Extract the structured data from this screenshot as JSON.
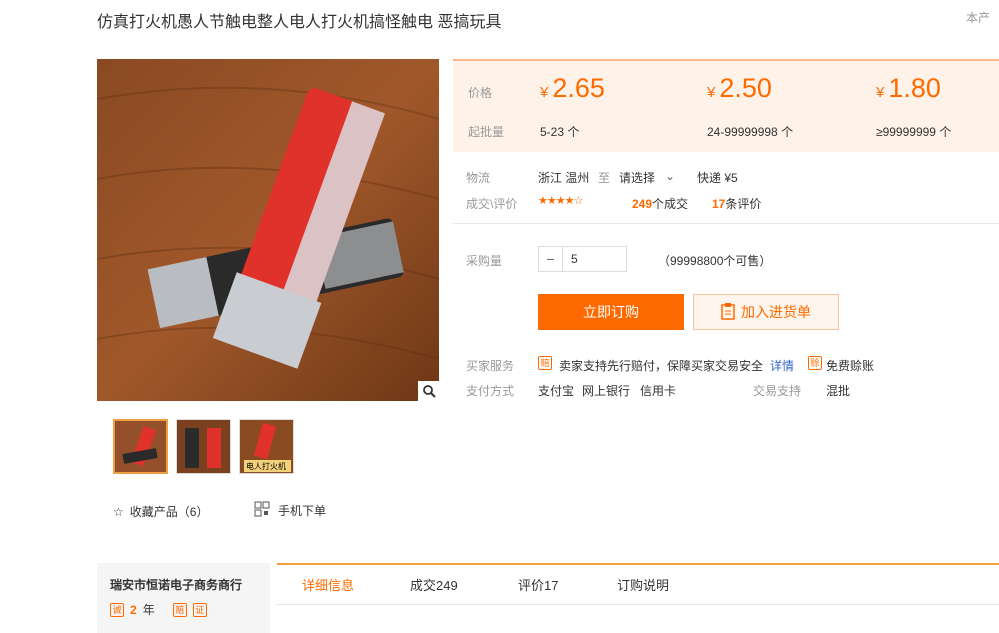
{
  "title": "仿真打火机愚人节触电整人电人打火机搞怪触电 恶搞玩具",
  "corner_text": "本产",
  "price": {
    "price_label": "价格",
    "batch_label": "起批量",
    "currency": "¥",
    "tiers": [
      {
        "price": "2.65",
        "range": "5-23 个"
      },
      {
        "price": "2.50",
        "range": "24-99999998 个"
      },
      {
        "price": "1.80",
        "range": "≥99999999 个"
      }
    ]
  },
  "logistics": {
    "label": "物流",
    "from": "浙江 温州",
    "to_word": "至",
    "select": "请选择",
    "shipping": "快递 ¥5"
  },
  "deals": {
    "label": "成交\\评价",
    "rating": 4.5,
    "sold_count": "249",
    "sold_suffix": "个成交",
    "review_count": "17",
    "review_suffix": "条评价"
  },
  "purchase": {
    "label": "采购量",
    "minus": "−",
    "value": "5",
    "available": "（99998800个可售）"
  },
  "buttons": {
    "buy_now": "立即订购",
    "add_cart": "加入进货单"
  },
  "services": {
    "buyer_label": "买家服务",
    "buyer_text": "卖家支持先行赔付，保障买家交易安全",
    "detail_link": "详情",
    "free_text": "免费赊账",
    "pay_label": "支付方式",
    "pay_methods": [
      "支付宝",
      "网上银行",
      "信用卡"
    ],
    "trade_label": "交易支持",
    "trade_value": "混批"
  },
  "actions": {
    "favorite": "收藏产品（6）",
    "mobile": "手机下单"
  },
  "thumb_caption": "电人打火机",
  "shop": {
    "name": "瑞安市恒诺电子商务商行",
    "years": "2",
    "years_unit": "年"
  },
  "tabs": [
    "详细信息",
    "成交249",
    "评价17",
    "订购说明"
  ],
  "colors": {
    "accent": "#ff6a00",
    "price_bg": "#fff2e8"
  }
}
